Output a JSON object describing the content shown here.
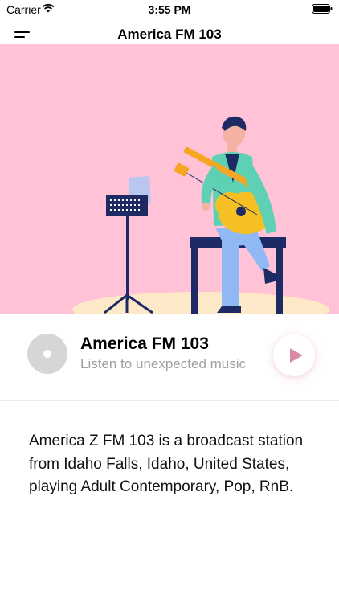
{
  "status_bar": {
    "carrier": "Carrier",
    "time": "3:55 PM",
    "icons": [
      "wifi-icon",
      "battery-icon"
    ]
  },
  "nav": {
    "title": "America FM 103",
    "menu_icon": "menu-icon"
  },
  "hero": {
    "illustration": "guitarist-playing-acoustic-guitar",
    "background_color": "#ffc2d7"
  },
  "player": {
    "station_name": "America FM 103",
    "tagline": "Listen to unexpected music",
    "disc_icon": "vinyl-disc-icon",
    "play_icon": "play-icon",
    "accent_color": "#d98aa6"
  },
  "description": {
    "text": "America Z FM 103 is a broadcast station from Idaho Falls, Idaho, United States, playing Adult Contemporary, Pop, RnB."
  }
}
